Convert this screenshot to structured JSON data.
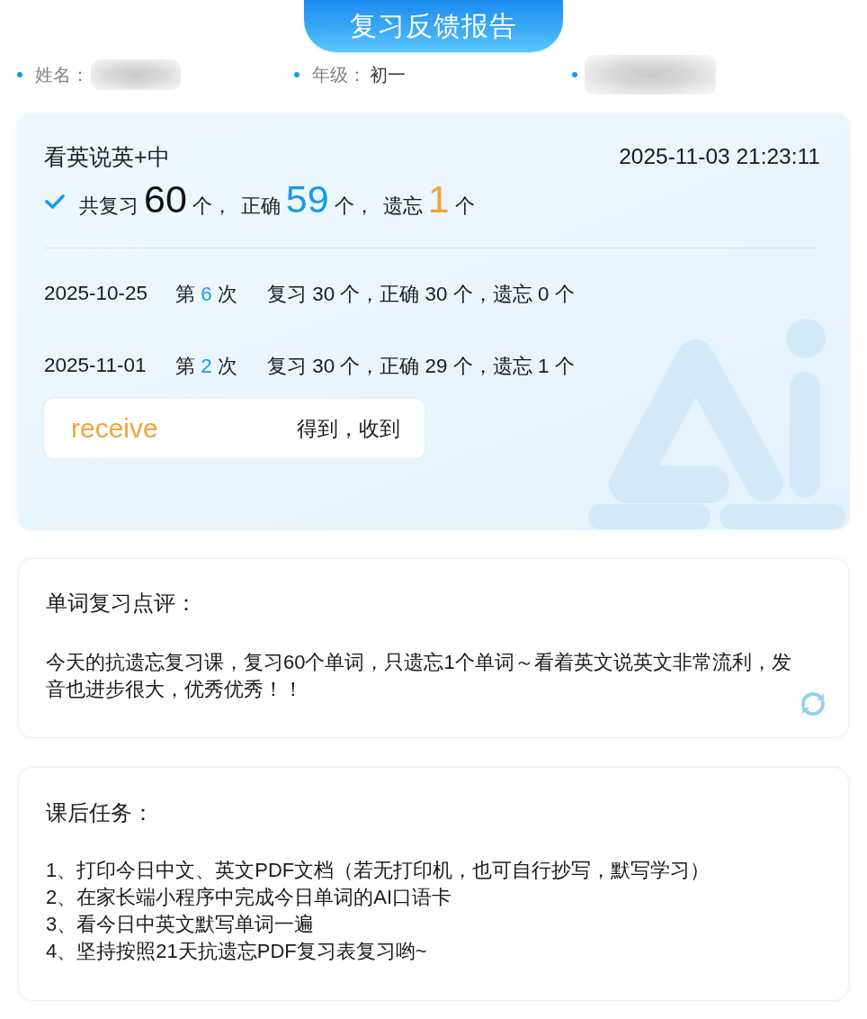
{
  "header": {
    "title": "复习反馈报告"
  },
  "student_info": [
    {
      "label": "姓名：",
      "redacted": true
    },
    {
      "label": "年级：",
      "value": "初一",
      "redacted": false
    },
    {
      "redacted": true
    }
  ],
  "review": {
    "mode": "看英说英+中",
    "datetime": "2025-11-03 21:23:11",
    "summary": [
      {
        "label": "共复习",
        "value": "60",
        "unit": "个，",
        "color": "#111111"
      },
      {
        "label": "正确",
        "value": "59",
        "unit": "个，",
        "color": "#1a9be8"
      },
      {
        "label": "遗忘",
        "value": "1",
        "unit": "个",
        "color": "#f0a439"
      }
    ],
    "history": [
      {
        "date": "2025-10-25",
        "round_prefix": "第",
        "round_number": "6",
        "round_suffix": "次",
        "result": "复习 30 个，正确 30 个，遗忘 0 个"
      },
      {
        "date": "2025-11-01",
        "round_prefix": "第",
        "round_number": "2",
        "round_suffix": "次",
        "result": "复习 30 个，正确 29 个，遗忘 1 个"
      }
    ],
    "words": [
      {
        "word": "receive",
        "meaning": "得到，收到"
      }
    ]
  },
  "comment": {
    "heading": "单词复习点评：",
    "text": "今天的抗遗忘复习课，复习60个单词，只遗忘1个单词～看着英文说英文非常流利，发音也进步很大，优秀优秀！！"
  },
  "tasks": {
    "heading": "课后任务：",
    "items": [
      "1、打印今日中文、英文PDF文档（若无打印机，也可自行抄写，默写学习）",
      "2、在家长端小程序中完成今日单词的AI口语卡",
      "3、看今日中英文默写单词一遍",
      "4、坚持按照21天抗遗忘PDF复习表复习哟~"
    ]
  }
}
